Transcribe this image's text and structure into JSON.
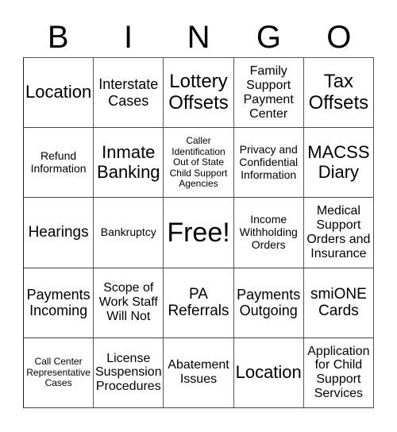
{
  "header": {
    "letters": [
      "B",
      "I",
      "N",
      "G",
      "O"
    ]
  },
  "grid": {
    "rows": [
      [
        "Location",
        "Interstate Cases",
        "Lottery Offsets",
        "Family Support Payment Center",
        "Tax Offsets"
      ],
      [
        "Refund Information",
        "Inmate Banking",
        "Caller Identification Out of State Child Support Agencies",
        "Privacy and Confidential Information",
        "MACSS Diary"
      ],
      [
        "Hearings",
        "Bankruptcy",
        "Free!",
        "Income Withholding Orders",
        "Medical Support Orders and Insurance"
      ],
      [
        "Payments Incoming",
        "Scope of Work Staff Will Not",
        "PA Referrals",
        "Payments Outgoing",
        "smiONE Cards"
      ],
      [
        "Call Center Representative Cases",
        "License Suspension Procedures",
        "Abatement Issues",
        "Location",
        "Application for Child Support Services"
      ]
    ]
  }
}
